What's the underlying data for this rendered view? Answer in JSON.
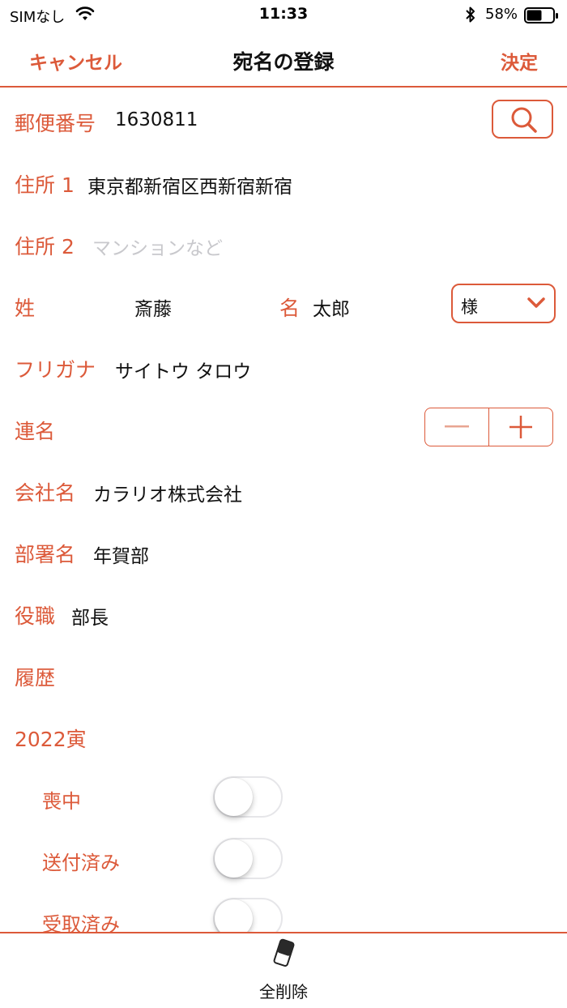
{
  "status_bar": {
    "carrier": "SIMなし",
    "time": "11:33",
    "battery_percent": "58%",
    "battery_level": 0.58,
    "icons": [
      "wifi-icon",
      "bluetooth-icon",
      "battery-icon"
    ]
  },
  "nav": {
    "cancel_label": "キャンセル",
    "title": "宛名の登録",
    "done_label": "決定"
  },
  "form": {
    "postal": {
      "label": "郵便番号",
      "value": "1630811",
      "search_icon": "search-icon"
    },
    "address1": {
      "label": "住所 1",
      "value": "東京都新宿区西新宿新宿"
    },
    "address2": {
      "label": "住所 2",
      "placeholder": "マンションなど"
    },
    "last_name": {
      "label": "姓",
      "value": "斎藤"
    },
    "first_name": {
      "label": "名",
      "value": "太郎"
    },
    "honorific": {
      "selected": "様",
      "icon": "chevron-down-icon"
    },
    "furigana": {
      "label": "フリガナ",
      "value": "サイトウ タロウ"
    },
    "joint_names": {
      "label": "連名",
      "minus_icon": "minus-icon",
      "plus_icon": "plus-icon"
    },
    "company": {
      "label": "会社名",
      "value": "カラリオ株式会社"
    },
    "department": {
      "label": "部署名",
      "value": "年賀部"
    },
    "position": {
      "label": "役職",
      "value": "部長"
    }
  },
  "history": {
    "label": "履歴",
    "year_label": "2022寅",
    "toggles": [
      {
        "label": "喪中",
        "on": false
      },
      {
        "label": "送付済み",
        "on": false
      },
      {
        "label": "受取済み",
        "on": false
      }
    ]
  },
  "toolbar": {
    "clear_all_label": "全削除",
    "clear_icon": "eraser-icon"
  },
  "colors": {
    "accent": "#dc5a3a",
    "placeholder": "#c8c8cc",
    "text": "#111111"
  }
}
